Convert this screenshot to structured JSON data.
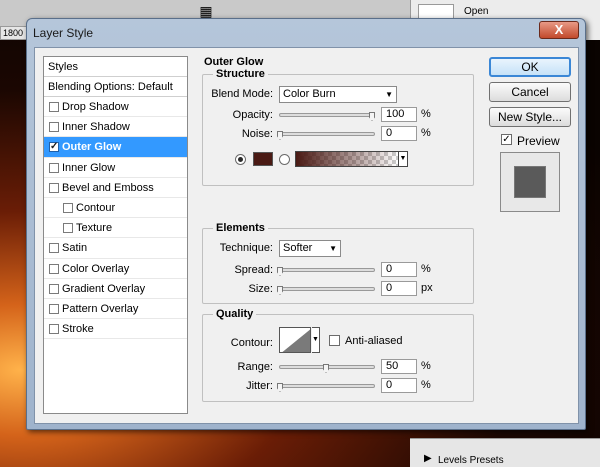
{
  "background": {
    "ruler_value": "1800",
    "open_label": "Open",
    "levels_label": "Levels Presets"
  },
  "dialog": {
    "title": "Layer Style",
    "close_glyph": "X"
  },
  "styles_list": {
    "header": "Styles",
    "blending": "Blending Options: Default",
    "items": [
      {
        "label": "Drop Shadow",
        "checked": false
      },
      {
        "label": "Inner Shadow",
        "checked": false
      },
      {
        "label": "Outer Glow",
        "checked": true,
        "selected": true
      },
      {
        "label": "Inner Glow",
        "checked": false
      },
      {
        "label": "Bevel and Emboss",
        "checked": false
      },
      {
        "label": "Contour",
        "checked": false,
        "indent": true
      },
      {
        "label": "Texture",
        "checked": false,
        "indent": true
      },
      {
        "label": "Satin",
        "checked": false
      },
      {
        "label": "Color Overlay",
        "checked": false
      },
      {
        "label": "Gradient Overlay",
        "checked": false
      },
      {
        "label": "Pattern Overlay",
        "checked": false
      },
      {
        "label": "Stroke",
        "checked": false
      }
    ]
  },
  "outer_glow": {
    "title": "Outer Glow",
    "structure": {
      "title": "Structure",
      "blend_mode_label": "Blend Mode:",
      "blend_mode_value": "Color Burn",
      "opacity_label": "Opacity:",
      "opacity_value": "100",
      "opacity_level": 1.0,
      "noise_label": "Noise:",
      "noise_value": "0",
      "noise_level": 0.0,
      "percent": "%",
      "glow_color": "#4a1a14"
    },
    "elements": {
      "title": "Elements",
      "technique_label": "Technique:",
      "technique_value": "Softer",
      "spread_label": "Spread:",
      "spread_value": "0",
      "spread_level": 0.0,
      "size_label": "Size:",
      "size_value": "0",
      "size_level": 0.0,
      "percent": "%",
      "px": "px"
    },
    "quality": {
      "title": "Quality",
      "contour_label": "Contour:",
      "anti_aliased_label": "Anti-aliased",
      "anti_aliased": false,
      "range_label": "Range:",
      "range_value": "50",
      "range_level": 0.5,
      "jitter_label": "Jitter:",
      "jitter_value": "0",
      "jitter_level": 0.0,
      "percent": "%"
    }
  },
  "buttons": {
    "ok": "OK",
    "cancel": "Cancel",
    "new_style": "New Style...",
    "preview_label": "Preview",
    "preview_checked": true
  },
  "colors": {
    "selection": "#3399ff",
    "glow_color": "#4a1a14"
  }
}
